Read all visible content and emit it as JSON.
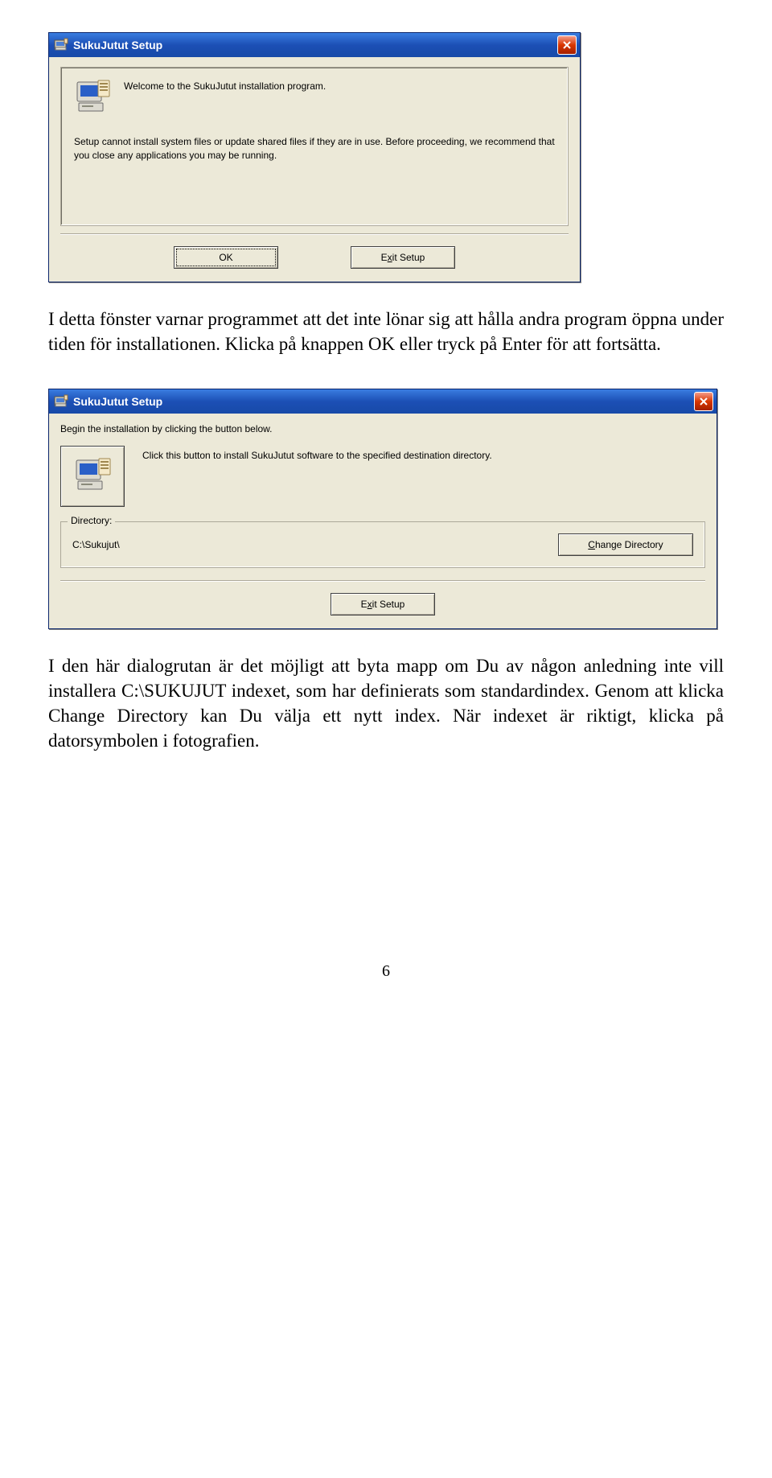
{
  "dialog1": {
    "title": "SukuJutut Setup",
    "welcome": "Welcome to the SukuJutut installation program.",
    "warning": "Setup cannot install system files or update shared files if they are in use. Before proceeding, we recommend that you close any applications you may be running.",
    "ok_label": "OK",
    "exit_prefix": "E",
    "exit_underline": "x",
    "exit_suffix": "it Setup"
  },
  "para1": "I detta fönster varnar programmet att det inte lönar sig att hålla andra program öppna under tiden för installationen. Klicka på knappen OK eller tryck på Enter för att fortsätta.",
  "dialog2": {
    "title": "SukuJutut Setup",
    "begin": "Begin the installation by clicking the button below.",
    "install_text": "Click this button to install SukuJutut software to the specified destination directory.",
    "dir_legend": "Directory:",
    "dir_path": "C:\\Sukujut\\",
    "change_underline": "C",
    "change_suffix": "hange Directory",
    "exit_prefix": "E",
    "exit_underline": "x",
    "exit_suffix": "it Setup"
  },
  "para2": "I den här dialogrutan är det möjligt att byta mapp om Du av någon anledning inte vill installera C:\\SUKUJUT indexet, som har definierats som standardindex. Genom att klicka Change Directory kan Du välja ett nytt index. När indexet är riktigt, klicka på datorsymbolen i fotografien.",
  "page_number": "6"
}
